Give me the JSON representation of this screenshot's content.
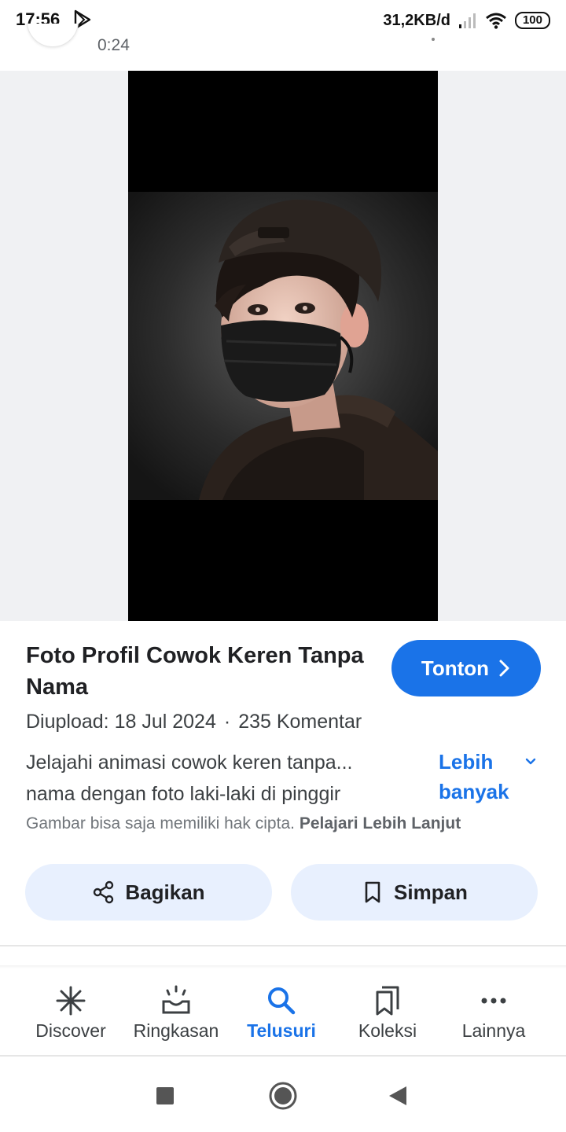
{
  "status_bar": {
    "time": "17:56",
    "network_speed": "31,2KB/d",
    "battery": "100",
    "icons": [
      "play-store-icon",
      "signal-icon",
      "wifi-icon",
      "battery-icon"
    ]
  },
  "previous_result": {
    "duration": "0:24"
  },
  "result": {
    "title": "Foto Profil Cowok Keren Tanpa Nama",
    "watch_label": "Tonton",
    "upload_date": "Diupload: 18 Jul 2024",
    "separator": "·",
    "comments": "235 Komentar",
    "description_line1": "Jelajahi animasi cowok keren tanpa...",
    "description_line2": "nama dengan foto laki-laki di pinggir",
    "more_label": "Lebih banyak",
    "copyright_text": "Gambar bisa saja memiliki hak cipta.",
    "learn_more": "Pelajari Lebih Lanjut",
    "share_label": "Bagikan",
    "save_label": "Simpan"
  },
  "bottom_nav": {
    "items": [
      {
        "label": "Discover",
        "icon": "asterisk-icon"
      },
      {
        "label": "Ringkasan",
        "icon": "sunrise-tray-icon"
      },
      {
        "label": "Telusuri",
        "icon": "search-icon",
        "active": true
      },
      {
        "label": "Koleksi",
        "icon": "bookmarks-icon"
      },
      {
        "label": "Lainnya",
        "icon": "more-dots-icon"
      }
    ]
  },
  "colors": {
    "accent": "#1a73e8",
    "pill_bg": "#e8f0fe",
    "preview_bg": "#f0f1f3"
  }
}
